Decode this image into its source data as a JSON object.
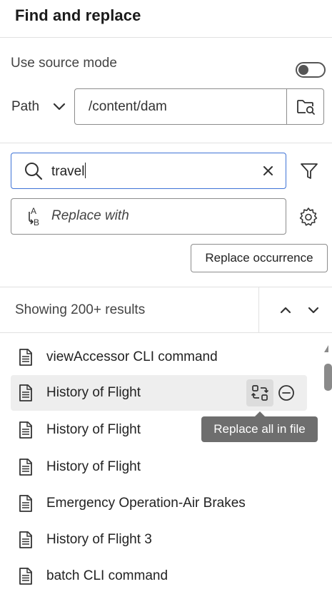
{
  "panel": {
    "title": "Find and replace"
  },
  "source_mode": {
    "label": "Use source mode",
    "enabled": false
  },
  "path": {
    "label": "Path",
    "value": "/content/dam"
  },
  "search": {
    "value": "travel"
  },
  "replace": {
    "placeholder": "Replace with"
  },
  "buttons": {
    "replace_occurrence": "Replace occurrence"
  },
  "results": {
    "summary": "Showing 200+ results"
  },
  "items": [
    {
      "label": "viewAccessor CLI command",
      "selected": false
    },
    {
      "label": "History of Flight",
      "selected": true
    },
    {
      "label": "History of Flight",
      "selected": false
    },
    {
      "label": "History of Flight",
      "selected": false
    },
    {
      "label": "Emergency Operation-Air Brakes",
      "selected": false
    },
    {
      "label": "History of Flight 3",
      "selected": false
    },
    {
      "label": "batch CLI command",
      "selected": false
    }
  ],
  "tooltip": {
    "text": "Replace all in file"
  },
  "icons": {
    "path_dropdown": "chevron-down-icon",
    "path_browse": "folder-search-icon",
    "search": "search-icon",
    "clear": "close-icon",
    "filter": "filter-icon",
    "replace": "replace-ab-icon",
    "settings": "gear-icon",
    "prev": "chevron-up-icon",
    "next": "chevron-down-icon",
    "file": "document-icon",
    "replace_in_file": "replace-in-file-icon",
    "remove": "remove-circle-icon"
  },
  "colors": {
    "focus_border": "#3f73d6",
    "selected_row": "#eeeeee",
    "tooltip_bg": "#6e6e6e"
  }
}
